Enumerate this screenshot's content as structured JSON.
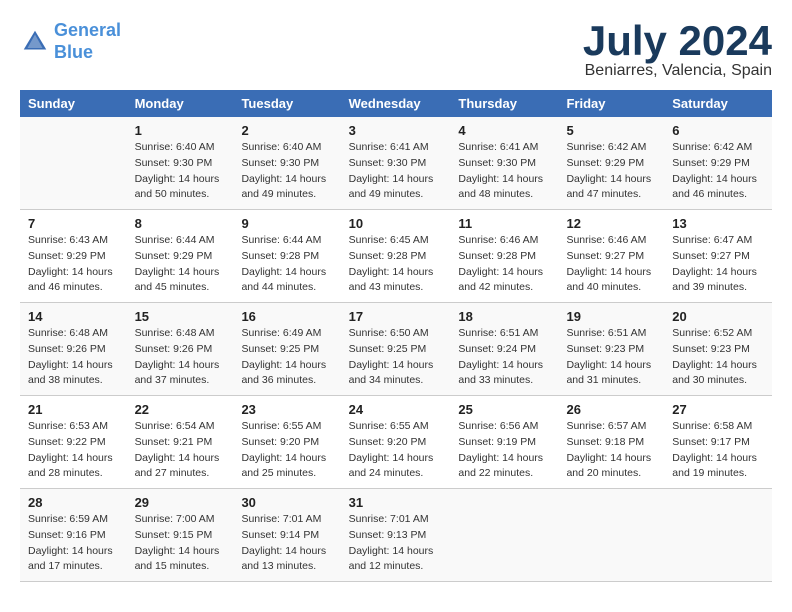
{
  "logo": {
    "line1": "General",
    "line2": "Blue"
  },
  "title": {
    "month_year": "July 2024",
    "location": "Beniarres, Valencia, Spain"
  },
  "columns": [
    "Sunday",
    "Monday",
    "Tuesday",
    "Wednesday",
    "Thursday",
    "Friday",
    "Saturday"
  ],
  "weeks": [
    [
      {
        "day": "",
        "sunrise": "",
        "sunset": "",
        "daylight": ""
      },
      {
        "day": "1",
        "sunrise": "Sunrise: 6:40 AM",
        "sunset": "Sunset: 9:30 PM",
        "daylight": "Daylight: 14 hours and 50 minutes."
      },
      {
        "day": "2",
        "sunrise": "Sunrise: 6:40 AM",
        "sunset": "Sunset: 9:30 PM",
        "daylight": "Daylight: 14 hours and 49 minutes."
      },
      {
        "day": "3",
        "sunrise": "Sunrise: 6:41 AM",
        "sunset": "Sunset: 9:30 PM",
        "daylight": "Daylight: 14 hours and 49 minutes."
      },
      {
        "day": "4",
        "sunrise": "Sunrise: 6:41 AM",
        "sunset": "Sunset: 9:30 PM",
        "daylight": "Daylight: 14 hours and 48 minutes."
      },
      {
        "day": "5",
        "sunrise": "Sunrise: 6:42 AM",
        "sunset": "Sunset: 9:29 PM",
        "daylight": "Daylight: 14 hours and 47 minutes."
      },
      {
        "day": "6",
        "sunrise": "Sunrise: 6:42 AM",
        "sunset": "Sunset: 9:29 PM",
        "daylight": "Daylight: 14 hours and 46 minutes."
      }
    ],
    [
      {
        "day": "7",
        "sunrise": "Sunrise: 6:43 AM",
        "sunset": "Sunset: 9:29 PM",
        "daylight": "Daylight: 14 hours and 46 minutes."
      },
      {
        "day": "8",
        "sunrise": "Sunrise: 6:44 AM",
        "sunset": "Sunset: 9:29 PM",
        "daylight": "Daylight: 14 hours and 45 minutes."
      },
      {
        "day": "9",
        "sunrise": "Sunrise: 6:44 AM",
        "sunset": "Sunset: 9:28 PM",
        "daylight": "Daylight: 14 hours and 44 minutes."
      },
      {
        "day": "10",
        "sunrise": "Sunrise: 6:45 AM",
        "sunset": "Sunset: 9:28 PM",
        "daylight": "Daylight: 14 hours and 43 minutes."
      },
      {
        "day": "11",
        "sunrise": "Sunrise: 6:46 AM",
        "sunset": "Sunset: 9:28 PM",
        "daylight": "Daylight: 14 hours and 42 minutes."
      },
      {
        "day": "12",
        "sunrise": "Sunrise: 6:46 AM",
        "sunset": "Sunset: 9:27 PM",
        "daylight": "Daylight: 14 hours and 40 minutes."
      },
      {
        "day": "13",
        "sunrise": "Sunrise: 6:47 AM",
        "sunset": "Sunset: 9:27 PM",
        "daylight": "Daylight: 14 hours and 39 minutes."
      }
    ],
    [
      {
        "day": "14",
        "sunrise": "Sunrise: 6:48 AM",
        "sunset": "Sunset: 9:26 PM",
        "daylight": "Daylight: 14 hours and 38 minutes."
      },
      {
        "day": "15",
        "sunrise": "Sunrise: 6:48 AM",
        "sunset": "Sunset: 9:26 PM",
        "daylight": "Daylight: 14 hours and 37 minutes."
      },
      {
        "day": "16",
        "sunrise": "Sunrise: 6:49 AM",
        "sunset": "Sunset: 9:25 PM",
        "daylight": "Daylight: 14 hours and 36 minutes."
      },
      {
        "day": "17",
        "sunrise": "Sunrise: 6:50 AM",
        "sunset": "Sunset: 9:25 PM",
        "daylight": "Daylight: 14 hours and 34 minutes."
      },
      {
        "day": "18",
        "sunrise": "Sunrise: 6:51 AM",
        "sunset": "Sunset: 9:24 PM",
        "daylight": "Daylight: 14 hours and 33 minutes."
      },
      {
        "day": "19",
        "sunrise": "Sunrise: 6:51 AM",
        "sunset": "Sunset: 9:23 PM",
        "daylight": "Daylight: 14 hours and 31 minutes."
      },
      {
        "day": "20",
        "sunrise": "Sunrise: 6:52 AM",
        "sunset": "Sunset: 9:23 PM",
        "daylight": "Daylight: 14 hours and 30 minutes."
      }
    ],
    [
      {
        "day": "21",
        "sunrise": "Sunrise: 6:53 AM",
        "sunset": "Sunset: 9:22 PM",
        "daylight": "Daylight: 14 hours and 28 minutes."
      },
      {
        "day": "22",
        "sunrise": "Sunrise: 6:54 AM",
        "sunset": "Sunset: 9:21 PM",
        "daylight": "Daylight: 14 hours and 27 minutes."
      },
      {
        "day": "23",
        "sunrise": "Sunrise: 6:55 AM",
        "sunset": "Sunset: 9:20 PM",
        "daylight": "Daylight: 14 hours and 25 minutes."
      },
      {
        "day": "24",
        "sunrise": "Sunrise: 6:55 AM",
        "sunset": "Sunset: 9:20 PM",
        "daylight": "Daylight: 14 hours and 24 minutes."
      },
      {
        "day": "25",
        "sunrise": "Sunrise: 6:56 AM",
        "sunset": "Sunset: 9:19 PM",
        "daylight": "Daylight: 14 hours and 22 minutes."
      },
      {
        "day": "26",
        "sunrise": "Sunrise: 6:57 AM",
        "sunset": "Sunset: 9:18 PM",
        "daylight": "Daylight: 14 hours and 20 minutes."
      },
      {
        "day": "27",
        "sunrise": "Sunrise: 6:58 AM",
        "sunset": "Sunset: 9:17 PM",
        "daylight": "Daylight: 14 hours and 19 minutes."
      }
    ],
    [
      {
        "day": "28",
        "sunrise": "Sunrise: 6:59 AM",
        "sunset": "Sunset: 9:16 PM",
        "daylight": "Daylight: 14 hours and 17 minutes."
      },
      {
        "day": "29",
        "sunrise": "Sunrise: 7:00 AM",
        "sunset": "Sunset: 9:15 PM",
        "daylight": "Daylight: 14 hours and 15 minutes."
      },
      {
        "day": "30",
        "sunrise": "Sunrise: 7:01 AM",
        "sunset": "Sunset: 9:14 PM",
        "daylight": "Daylight: 14 hours and 13 minutes."
      },
      {
        "day": "31",
        "sunrise": "Sunrise: 7:01 AM",
        "sunset": "Sunset: 9:13 PM",
        "daylight": "Daylight: 14 hours and 12 minutes."
      },
      {
        "day": "",
        "sunrise": "",
        "sunset": "",
        "daylight": ""
      },
      {
        "day": "",
        "sunrise": "",
        "sunset": "",
        "daylight": ""
      },
      {
        "day": "",
        "sunrise": "",
        "sunset": "",
        "daylight": ""
      }
    ]
  ]
}
